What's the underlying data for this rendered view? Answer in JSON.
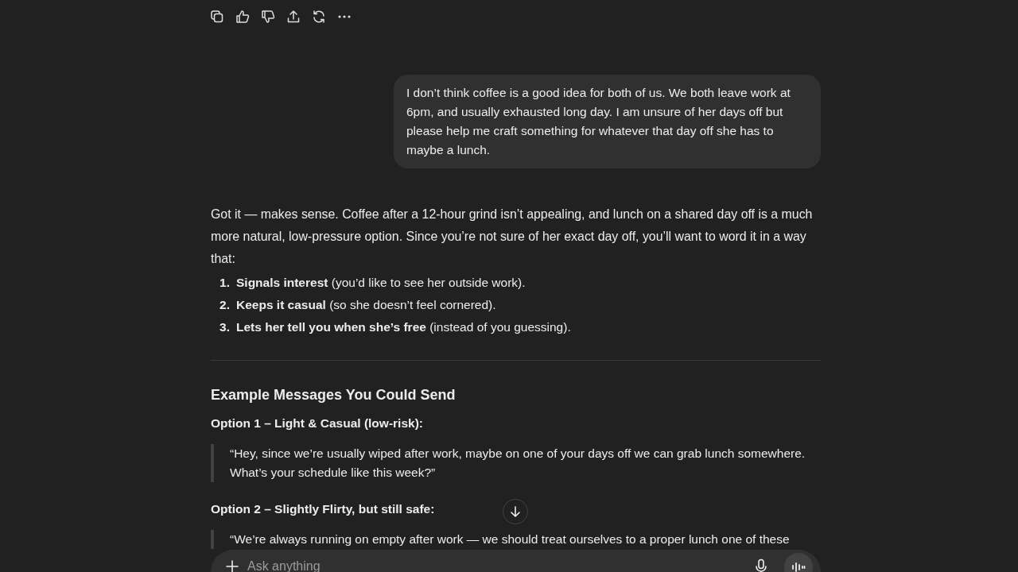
{
  "actions": [
    {
      "kind": "copy"
    },
    {
      "kind": "like"
    },
    {
      "kind": "dislike"
    },
    {
      "kind": "share"
    },
    {
      "kind": "retry"
    },
    {
      "kind": "more"
    }
  ],
  "user_message": "I don’t think coffee is a good idea for both of us. We both leave work at 6pm, and usually exhausted long day. I am unsure of her days off but please help me craft something for whatever that day off she has to maybe a lunch.",
  "reply": {
    "intro": "Got it — makes sense. Coffee after a 12-hour grind isn’t appealing, and lunch on a shared day off is a much more natural, low-pressure option. Since you’re not sure of her exact day off, you’ll want to word it in a way that:",
    "points": [
      {
        "number": "1.",
        "text": "**Signals interest** (you’d like to see her outside work)."
      },
      {
        "number": "2.",
        "text": "**Keeps it casual** (so she doesn’t feel cornered)."
      },
      {
        "number": "3.",
        "text": "**Lets her tell you when she’s free** (instead of you guessing)."
      }
    ],
    "heading": "Example Messages You Could Send",
    "options": [
      {
        "title": "Option 1 – Light & Casual (low-risk):",
        "quote": "“Hey, since we’re usually wiped after work, maybe on one of your days off we can grab lunch somewhere. What’s your schedule like this week?”"
      },
      {
        "title": "Option 2 – Slightly Flirty, but still safe:",
        "quote": "“We’re always running on empty after work — we should treat ourselves to a proper lunch one of these"
      }
    ]
  },
  "composer": {
    "placeholder": "Ask anything"
  }
}
